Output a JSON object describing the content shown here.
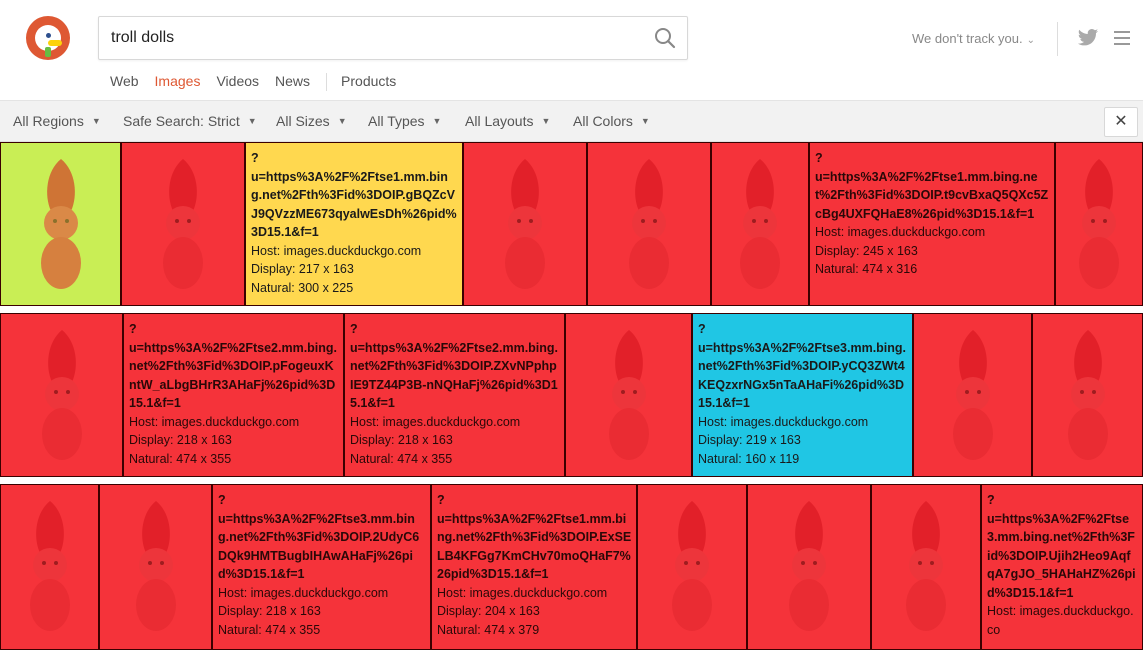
{
  "search": {
    "query": "troll dolls"
  },
  "header": {
    "track_label": "We don't track you."
  },
  "tabs": [
    {
      "label": "Web"
    },
    {
      "label": "Images"
    },
    {
      "label": "Videos"
    },
    {
      "label": "News"
    },
    {
      "label": "Products"
    }
  ],
  "filters": {
    "regions": "All Regions",
    "safe_search": "Safe Search: Strict",
    "sizes": "All Sizes",
    "types": "All Types",
    "layouts": "All Layouts",
    "colors": "All Colors",
    "close": "✕"
  },
  "tiles": [
    {
      "url": "",
      "host": "",
      "display": "",
      "natural": "",
      "q": ""
    },
    {
      "url": "",
      "host": "",
      "display": "",
      "natural": "",
      "q": ""
    },
    {
      "q": "?",
      "url": "u=https%3A%2F%2Ftse1.mm.bing.net%2Fth%3Fid%3DOIP.gBQZcVJ9QVzzME673qyalwEsDh%26pid%3D15.1&f=1",
      "host": "Host: images.duckduckgo.com",
      "display": "Display: 217 x 163",
      "natural": "Natural: 300 x 225"
    },
    {
      "url": "",
      "host": "",
      "display": "",
      "natural": "",
      "q": ""
    },
    {
      "url": "",
      "host": "",
      "display": "",
      "natural": "",
      "q": ""
    },
    {
      "url": "",
      "host": "",
      "display": "",
      "natural": "",
      "q": ""
    },
    {
      "q": "?",
      "url": "u=https%3A%2F%2Ftse1.mm.bing.net%2Fth%3Fid%3DOIP.t9cvBxaQ5QXc5ZcBg4UXFQHaE8%26pid%3D15.1&f=1",
      "host": "Host: images.duckduckgo.com",
      "display": "Display: 245 x 163",
      "natural": "Natural: 474 x 316"
    },
    {
      "url": "",
      "host": "",
      "display": "",
      "natural": "",
      "q": ""
    },
    {
      "url": "",
      "host": "",
      "display": "",
      "natural": "",
      "q": ""
    },
    {
      "q": "?",
      "url": "u=https%3A%2F%2Ftse2.mm.bing.net%2Fth%3Fid%3DOIP.pFogeuxKntW_aLbgBHrR3AHaFj%26pid%3D15.1&f=1",
      "host": "Host: images.duckduckgo.com",
      "display": "Display: 218 x 163",
      "natural": "Natural: 474 x 355"
    },
    {
      "q": "?",
      "url": "u=https%3A%2F%2Ftse2.mm.bing.net%2Fth%3Fid%3DOIP.ZXvNPphpIE9TZ44P3B-nNQHaFj%26pid%3D15.1&f=1",
      "host": "Host: images.duckduckgo.com",
      "display": "Display: 218 x 163",
      "natural": "Natural: 474 x 355"
    },
    {
      "url": "",
      "host": "",
      "display": "",
      "natural": "",
      "q": ""
    },
    {
      "q": "?",
      "url": "u=https%3A%2F%2Ftse3.mm.bing.net%2Fth%3Fid%3DOIP.yCQ3ZWt4KEQzxrNGx5nTaAHaFi%26pid%3D15.1&f=1",
      "host": "Host: images.duckduckgo.com",
      "display": "Display: 219 x 163",
      "natural": "Natural: 160 x 119"
    },
    {
      "url": "",
      "host": "",
      "display": "",
      "natural": "",
      "q": ""
    },
    {
      "url": "",
      "host": "",
      "display": "",
      "natural": "",
      "q": ""
    },
    {
      "url": "",
      "host": "",
      "display": "",
      "natural": "",
      "q": ""
    },
    {
      "url": "",
      "host": "",
      "display": "",
      "natural": "",
      "q": ""
    },
    {
      "q": "?",
      "url": "u=https%3A%2F%2Ftse3.mm.bing.net%2Fth%3Fid%3DOIP.2UdyC6DQk9HMTBugbIHAwAHaFj%26pid%3D15.1&f=1",
      "host": "Host: images.duckduckgo.com",
      "display": "Display: 218 x 163",
      "natural": "Natural: 474 x 355"
    },
    {
      "q": "?",
      "url": "u=https%3A%2F%2Ftse1.mm.bing.net%2Fth%3Fid%3DOIP.ExSELB4KFGg7KmCHv70moQHaF7%26pid%3D15.1&f=1",
      "host": "Host: images.duckduckgo.com",
      "display": "Display: 204 x 163",
      "natural": "Natural: 474 x 379"
    },
    {
      "url": "",
      "host": "",
      "display": "",
      "natural": "",
      "q": ""
    },
    {
      "url": "",
      "host": "",
      "display": "",
      "natural": "",
      "q": ""
    },
    {
      "url": "",
      "host": "",
      "display": "",
      "natural": "",
      "q": ""
    },
    {
      "q": "?",
      "url": "u=https%3A%2F%2Ftse3.mm.bing.net%2Fth%3Fid%3DOIP.Ujih2Heo9AqfqA7gJO_5HAHaHZ%26pid%3D15.1&f=1",
      "host": "Host: images.duckduckgo.co",
      "display": "",
      "natural": ""
    }
  ]
}
